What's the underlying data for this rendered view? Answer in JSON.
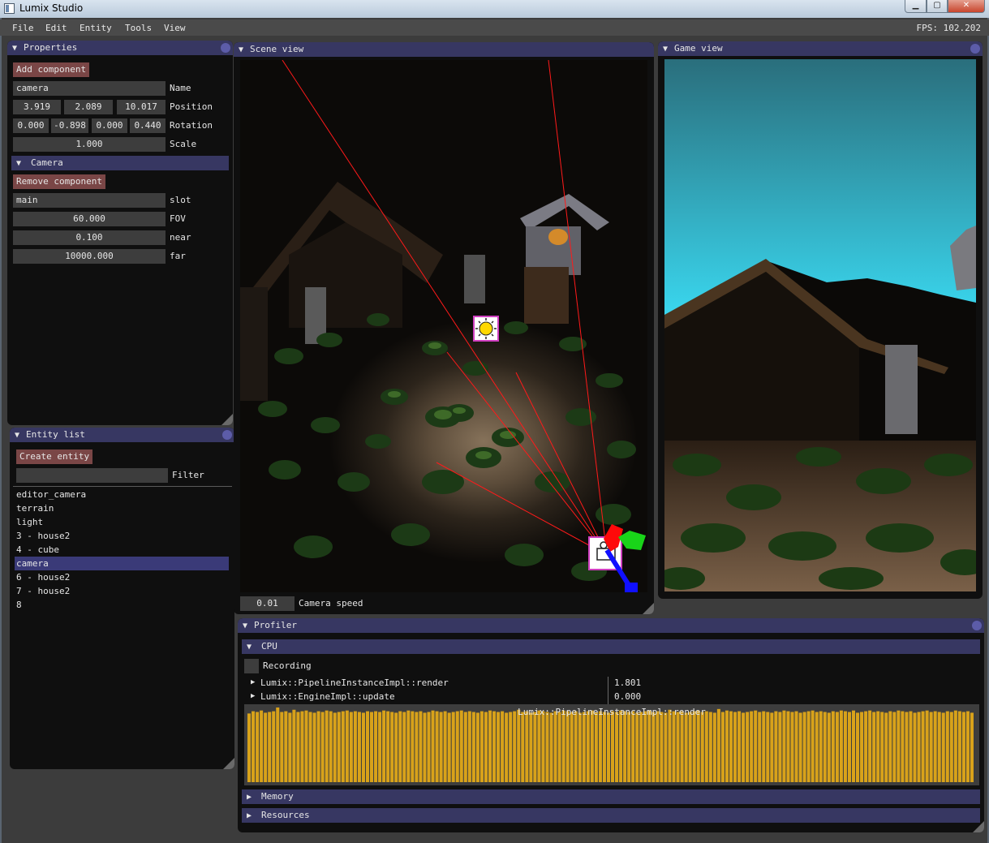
{
  "window": {
    "title": "Lumix Studio",
    "minimize_glyph": "▁",
    "maximize_glyph": "▢",
    "close_glyph": "✕"
  },
  "menu": {
    "items": [
      "File",
      "Edit",
      "Entity",
      "Tools",
      "View"
    ],
    "fps_text": "FPS: 102.202"
  },
  "properties": {
    "title": "Properties",
    "add_component": "Add component",
    "name_value": "camera",
    "name_label": "Name",
    "position": [
      "3.919",
      "2.089",
      "10.017"
    ],
    "position_label": "Position",
    "rotation": [
      "0.000",
      "-0.898",
      "0.000",
      "0.440"
    ],
    "rotation_label": "Rotation",
    "scale_value": "1.000",
    "scale_label": "Scale",
    "camera_header": "Camera",
    "remove_component": "Remove component",
    "slot_value": "main",
    "slot_label": "slot",
    "fov_value": "60.000",
    "fov_label": "FOV",
    "near_value": "0.100",
    "near_label": "near",
    "far_value": "10000.000",
    "far_label": "far"
  },
  "entity_list": {
    "title": "Entity list",
    "create_entity": "Create entity",
    "filter_value": "",
    "filter_label": "Filter",
    "items": [
      "editor_camera",
      "terrain",
      "light",
      "3 - house2",
      "4 - cube",
      "camera",
      "6 - house2",
      "7 - house2",
      "8"
    ],
    "selected_index": 5
  },
  "scene_view": {
    "title": "Scene view",
    "camera_speed_value": "0.01",
    "camera_speed_label": "Camera speed"
  },
  "game_view": {
    "title": "Game view"
  },
  "profiler": {
    "title": "Profiler",
    "cpu_header": "CPU",
    "recording_label": "Recording",
    "rows": [
      {
        "name": "Lumix::PipelineInstanceImpl::render",
        "value": "1.801"
      },
      {
        "name": "Lumix::EngineImpl::update",
        "value": "0.000"
      }
    ],
    "histogram_title": "Lumix::PipelineInstanceImpl::render",
    "memory_header": "Memory",
    "resources_header": "Resources",
    "histogram_color": "#d8a21a",
    "histogram_values": [
      0.92,
      0.95,
      0.94,
      0.96,
      0.93,
      0.94,
      0.95,
      1.02,
      0.94,
      0.95,
      0.93,
      0.97,
      0.94,
      0.95,
      0.96,
      0.94,
      0.93,
      0.95,
      0.94,
      0.96,
      0.95,
      0.93,
      0.94,
      0.95,
      0.96,
      0.94,
      0.95,
      0.94,
      0.93,
      0.95,
      0.94,
      0.95,
      0.94,
      0.96,
      0.95,
      0.94,
      0.93,
      0.95,
      0.94,
      0.96,
      0.95,
      0.94,
      0.95,
      0.93,
      0.94,
      0.96,
      0.95,
      0.94,
      0.95,
      0.93,
      0.94,
      0.95,
      0.96,
      0.94,
      0.95,
      0.94,
      0.93,
      0.95,
      0.94,
      0.96,
      0.95,
      0.94,
      0.95,
      0.93,
      0.94,
      0.95,
      0.97,
      0.94,
      0.95,
      0.93,
      0.94,
      0.96,
      0.95,
      0.94,
      0.93,
      0.95,
      0.94,
      0.96,
      0.95,
      0.94,
      0.95,
      0.93,
      0.94,
      0.95,
      0.96,
      0.94,
      0.95,
      0.94,
      0.93,
      0.95,
      0.94,
      0.96,
      0.95,
      0.94,
      0.95,
      0.93,
      0.94,
      0.95,
      0.96,
      0.94,
      0.95,
      0.94,
      0.93,
      0.97,
      0.95,
      0.94,
      0.95,
      0.93,
      0.94,
      0.95,
      0.96,
      0.94,
      0.95,
      0.94,
      0.93,
      0.98,
      0.94,
      0.96,
      0.95,
      0.94,
      0.95,
      0.93,
      0.94,
      0.95,
      0.96,
      0.94,
      0.95,
      0.94,
      0.93,
      0.95,
      0.94,
      0.96,
      0.95,
      0.94,
      0.95,
      0.93,
      0.94,
      0.95,
      0.96,
      0.94,
      0.95,
      0.94,
      0.93,
      0.95,
      0.94,
      0.96,
      0.95,
      0.94,
      0.96,
      0.93,
      0.94,
      0.95,
      0.96,
      0.94,
      0.95,
      0.94,
      0.93,
      0.95,
      0.94,
      0.96,
      0.95,
      0.94,
      0.95,
      0.93,
      0.94,
      0.95,
      0.96,
      0.94,
      0.95,
      0.94,
      0.93,
      0.95,
      0.94,
      0.96,
      0.95,
      0.94,
      0.95,
      0.93
    ]
  }
}
